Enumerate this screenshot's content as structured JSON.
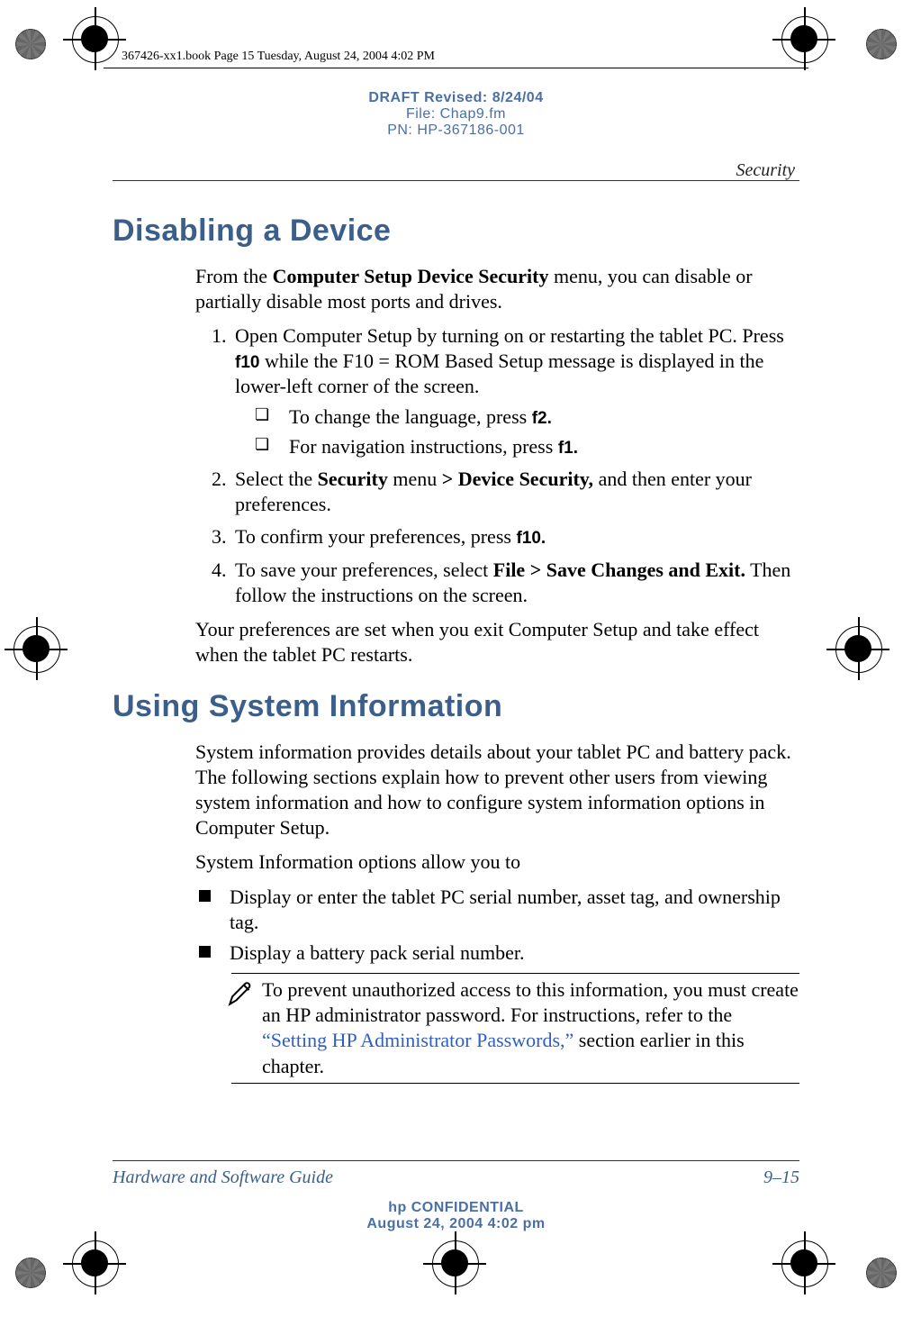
{
  "header": {
    "book_info": "367426-xx1.book  Page 15  Tuesday, August 24, 2004  4:02 PM",
    "draft_line1": "DRAFT Revised: 8/24/04",
    "draft_line2": "File: Chap9.fm",
    "draft_line3": "PN: HP-367186-001",
    "running": "Security"
  },
  "section1": {
    "title": "Disabling a Device",
    "intro_pre": "From the ",
    "intro_bold": "Computer Setup Device Security",
    "intro_post": " menu, you can disable or partially disable most ports and drives.",
    "steps": {
      "s1_a": "Open Computer Setup by turning on or restarting the tablet PC. Press ",
      "s1_key": "f10",
      "s1_b": " while the F10 = ROM Based Setup message is displayed in the lower-left corner of the screen.",
      "s1_sub1_a": "To change the language, press ",
      "s1_sub1_key": "f2.",
      "s1_sub2_a": "For navigation instructions, press ",
      "s1_sub2_key": "f1.",
      "s2_a": "Select the ",
      "s2_b": "Security",
      "s2_c": " menu ",
      "s2_d": "> Device Security,",
      "s2_e": " and then enter your preferences.",
      "s3_a": "To confirm your preferences, press ",
      "s3_key": "f10.",
      "s4_a": "To save your preferences, select ",
      "s4_b": "File > Save Changes and Exit.",
      "s4_c": " Then follow the instructions on the screen."
    },
    "outro": "Your preferences are set when you exit Computer Setup and take effect when the tablet PC restarts."
  },
  "section2": {
    "title": "Using System Information",
    "p1": "System information provides details about your tablet PC and battery pack. The following sections explain how to prevent other users from viewing system information and how to configure system information options in Computer Setup.",
    "p2": "System Information options allow you to",
    "bul1": "Display or enter the tablet PC serial number, asset tag, and ownership tag.",
    "bul2": "Display a battery pack serial number.",
    "note_a": "To prevent unauthorized access to this information, you must create an HP administrator password. For instructions, refer to the ",
    "note_link": "“Setting HP Administrator Passwords,”",
    "note_b": " section earlier in this chapter."
  },
  "footer": {
    "left": "Hardware and Software Guide",
    "right": "9–15",
    "conf1": "hp CONFIDENTIAL",
    "conf2": "August 24, 2004 4:02 pm"
  },
  "icons": {
    "pen": "✎"
  }
}
